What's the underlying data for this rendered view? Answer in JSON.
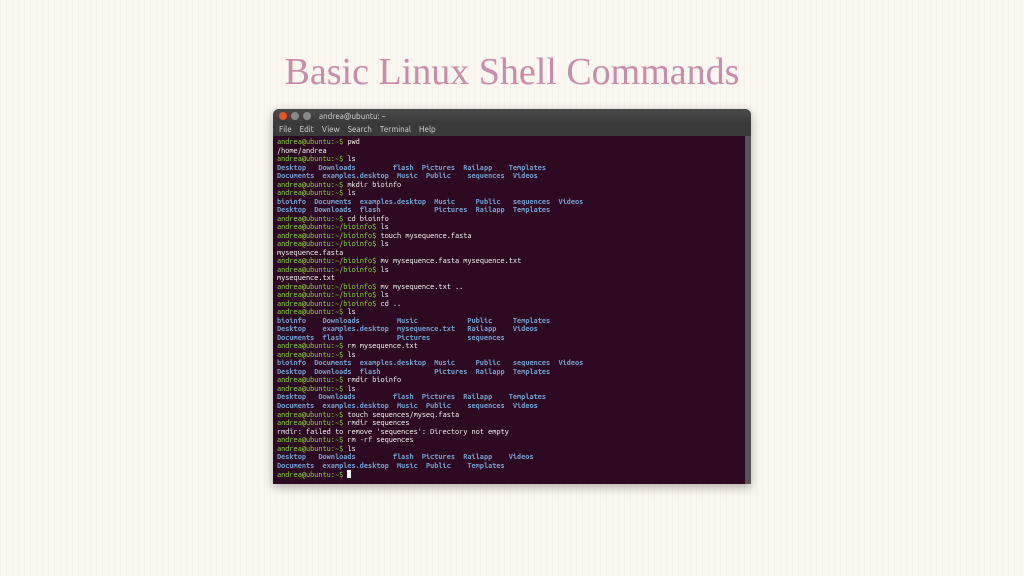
{
  "slide": {
    "title": "Basic Linux Shell Commands"
  },
  "window": {
    "title": "andrea@ubuntu: ~",
    "menu": [
      "File",
      "Edit",
      "View",
      "Search",
      "Terminal",
      "Help"
    ]
  },
  "p_home": "andrea@ubuntu:~$",
  "p_bio": "andrea@ubuntu:~/bioinfo$",
  "pwd_out": "/home/andrea",
  "cmd": {
    "pwd": " pwd",
    "ls": " ls",
    "mkdir": " mkdir bioinfo",
    "cd_bio": " cd bioinfo",
    "touch1": " touch mysequence.fasta",
    "mv1": " mv mysequence.fasta mysequence.txt",
    "mv2": " mv mysequence.txt ..",
    "cdup": " cd ..",
    "rm1": " rm mysequence.txt",
    "rmdir": " rmdir bioinfo",
    "touch2": " touch sequences/myseq.fasta",
    "rmdir2": " rmdir sequences",
    "rmrf": " rm -rf sequences"
  },
  "out": {
    "fasta": "mysequence.fasta",
    "txt": "mysequence.txt",
    "rmdir_err": "rmdir: failed to remove 'sequences': Directory not empty"
  },
  "ls1": {
    "a": "Desktop   Downloads         flash  Pictures  Railapp    Templates",
    "b": "Documents  examples.desktop  Music  Public    sequences  Videos"
  },
  "ls2": {
    "a": "bioinfo  Documents  examples.desktop  Music     Public   sequences  Videos",
    "b": "Desktop  Downloads  flash             Pictures  Railapp  Templates"
  },
  "ls3": {
    "a": "bioinfo    Downloads         Music            Public     Templates",
    "b": "Desktop    examples.desktop  mysequence.txt   Railapp    Videos",
    "c": "Documents  flash             Pictures         sequences"
  },
  "ls4": {
    "a": "bioinfo  Documents  examples.desktop  Music     Public   sequences  Videos",
    "b": "Desktop  Downloads  flash             Pictures  Railapp  Templates"
  },
  "ls5": {
    "a": "Desktop   Downloads         flash  Pictures  Railapp    Templates",
    "b": "Documents  examples.desktop  Music  Public    sequences  Videos"
  },
  "ls6": {
    "a": "Desktop   Downloads         flash  Pictures  Railapp    Videos",
    "b": "Documents  examples.desktop  Music  Public    Templates"
  },
  "blank": " "
}
